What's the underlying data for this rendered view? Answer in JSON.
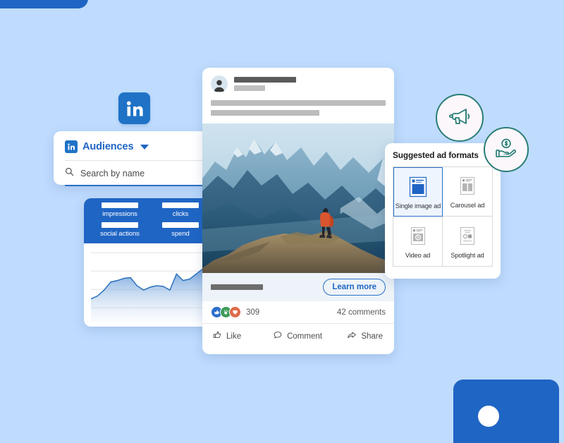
{
  "theme": {
    "background": "#bfdcfe",
    "brand_blue": "#1f65c4",
    "accent_blue": "#2a6fc9",
    "badge_teal": "#2b7d76"
  },
  "decorations": {
    "top_left_shape": "rounded-rect-blue",
    "bottom_right_shape": "rounded-rect-blue-with-dot"
  },
  "linkedin_logo": {
    "name": "linkedin-logo",
    "letters": "in"
  },
  "audiences_card": {
    "title": "Audiences",
    "dropdown_icon": "chevron-down-icon",
    "brand_icon": "linkedin-mark",
    "search": {
      "icon": "search-icon",
      "placeholder": "Search by name",
      "value": "Search by name"
    }
  },
  "analytics_card": {
    "metrics": [
      {
        "label": "impressions",
        "value": ""
      },
      {
        "label": "clicks",
        "value": ""
      },
      {
        "label": "social actions",
        "value": ""
      },
      {
        "label": "spend",
        "value": ""
      }
    ],
    "chart_data": {
      "type": "area",
      "title": "",
      "xlabel": "",
      "ylabel": "",
      "grid": true,
      "legend": "none",
      "ylim": [
        0,
        100
      ],
      "x": [
        0,
        1,
        2,
        3,
        4,
        5,
        6,
        7,
        8,
        9,
        10,
        11,
        12,
        13,
        14,
        15,
        16,
        17,
        18
      ],
      "series": [
        {
          "name": "impressions",
          "values": [
            32,
            36,
            44,
            55,
            57,
            60,
            61,
            50,
            44,
            48,
            50,
            49,
            44,
            66,
            57,
            59,
            66,
            73,
            78
          ]
        }
      ],
      "gridlines": [
        20,
        45,
        70,
        95
      ]
    }
  },
  "post_card": {
    "author": {
      "avatar": "profile-avatar",
      "name_placeholder": "",
      "subtitle_placeholder": ""
    },
    "body_placeholder_lines": 2,
    "image": {
      "name": "mountain-hiker-photo",
      "alt": "Hiker on rocky summit with mountain range"
    },
    "cta": {
      "headline_placeholder": "",
      "button_label": "Learn more"
    },
    "social": {
      "reactions": [
        "like-reaction",
        "clap-reaction",
        "love-reaction"
      ],
      "reaction_count": "309",
      "comments": "42 comments"
    },
    "actions": [
      {
        "label": "Like",
        "icon": "thumbs-up-icon"
      },
      {
        "label": "Comment",
        "icon": "comment-bubble-icon"
      },
      {
        "label": "Share",
        "icon": "share-arrow-icon"
      }
    ]
  },
  "ad_formats_panel": {
    "title": "Suggested ad formats",
    "formats": [
      {
        "label": "Single image ad",
        "icon": "single-image-ad-icon",
        "selected": true
      },
      {
        "label": "Carousel ad",
        "icon": "carousel-ad-icon",
        "selected": false
      },
      {
        "label": "Video ad",
        "icon": "video-ad-icon",
        "selected": false
      },
      {
        "label": "Spotlight ad",
        "icon": "spotlight-ad-icon",
        "selected": false
      }
    ]
  },
  "badges": [
    {
      "name": "megaphone-badge",
      "icon": "megaphone-icon"
    },
    {
      "name": "hand-money-badge",
      "icon": "hand-holding-coin-icon"
    }
  ]
}
